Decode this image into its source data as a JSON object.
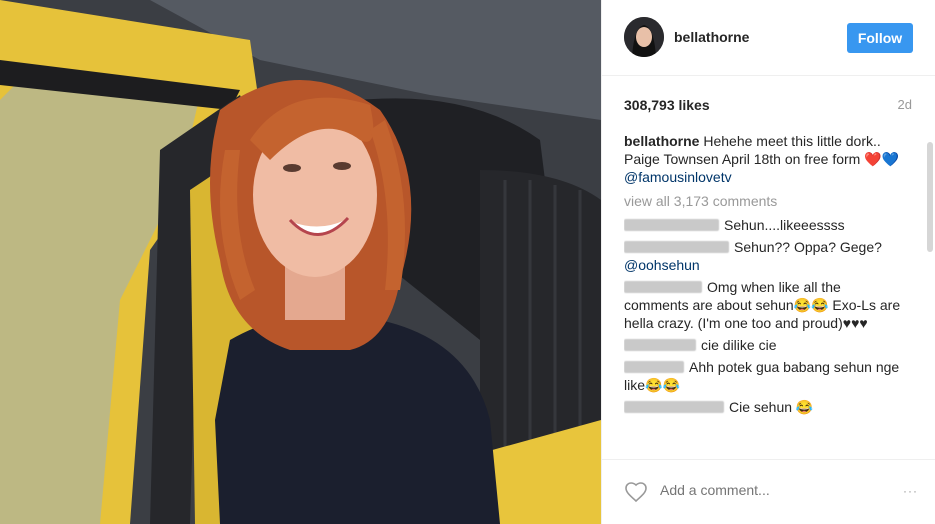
{
  "post": {
    "username": "bellathorne",
    "follow_label": "Follow",
    "likes": "308,793 likes",
    "time_ago": "2d",
    "caption": {
      "username": "bellathorne",
      "text": "Hehehe meet this little dork.. Paige Townsen April 18th on free form ❤️💙",
      "mention": "@famousinlovetv"
    },
    "view_all": "view all 3,173 comments",
    "comments": [
      {
        "user_width": 95,
        "text": "Sehun....likeeessss",
        "mention": ""
      },
      {
        "user_width": 105,
        "text": "Sehun?? Oppa? Gege?",
        "mention": "@oohsehun"
      },
      {
        "user_width": 78,
        "text": "Omg when like all the comments are about sehun😂😂 Exo-Ls are hella crazy. (I'm one too and proud)♥♥♥",
        "mention": ""
      },
      {
        "user_width": 72,
        "text": "cie dilike cie",
        "mention": ""
      },
      {
        "user_width": 60,
        "text": "Ahh potek gua babang sehun nge like😂😂",
        "mention": ""
      },
      {
        "user_width": 100,
        "text": "Cie sehun 😂",
        "mention": ""
      }
    ],
    "add_comment_placeholder": "Add a comment...",
    "more_icon": "···"
  },
  "colors": {
    "follow_bg": "#3897f0",
    "mention": "#003569",
    "muted": "#999999"
  },
  "icons": {
    "heart": "heart-outline-icon",
    "more": "ellipsis-icon"
  }
}
